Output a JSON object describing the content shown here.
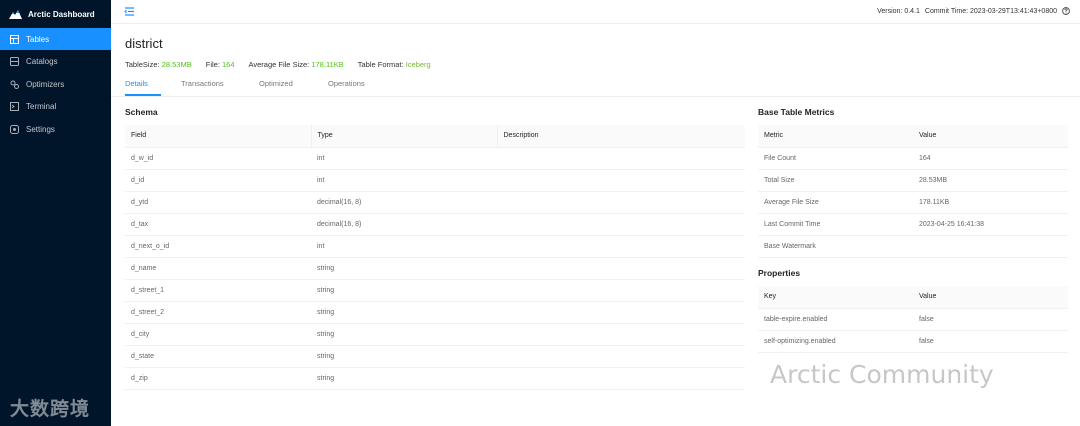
{
  "app": {
    "title": "Arctic Dashboard"
  },
  "nav": [
    {
      "label": "Tables",
      "icon": "table-icon",
      "active": true
    },
    {
      "label": "Catalogs",
      "icon": "database-icon",
      "active": false
    },
    {
      "label": "Optimizers",
      "icon": "gear-cluster-icon",
      "active": false
    },
    {
      "label": "Terminal",
      "icon": "terminal-icon",
      "active": false
    },
    {
      "label": "Settings",
      "icon": "settings-icon",
      "active": false
    }
  ],
  "topbar": {
    "version": "Version: 0.4.1",
    "commit": "Commit Time: 2023-03-29T13:41:43+0800"
  },
  "page": {
    "title": "district",
    "stats": [
      {
        "label": "TableSize:",
        "value": "28.53MB"
      },
      {
        "label": "File:",
        "value": "164"
      },
      {
        "label": "Average File Size:",
        "value": "178.11KB"
      },
      {
        "label": "Table Format:",
        "value": "Iceberg"
      }
    ]
  },
  "tabs": [
    "Details",
    "Transactions",
    "Optimized",
    "Operations"
  ],
  "schema": {
    "title": "Schema",
    "headers": [
      "Field",
      "Type",
      "Description"
    ],
    "rows": [
      [
        "d_w_id",
        "int",
        ""
      ],
      [
        "d_id",
        "int",
        ""
      ],
      [
        "d_ytd",
        "decimal(16, 8)",
        ""
      ],
      [
        "d_tax",
        "decimal(16, 8)",
        ""
      ],
      [
        "d_next_o_id",
        "int",
        ""
      ],
      [
        "d_name",
        "string",
        ""
      ],
      [
        "d_street_1",
        "string",
        ""
      ],
      [
        "d_street_2",
        "string",
        ""
      ],
      [
        "d_city",
        "string",
        ""
      ],
      [
        "d_state",
        "string",
        ""
      ],
      [
        "d_zip",
        "string",
        ""
      ]
    ]
  },
  "metrics": {
    "title": "Base Table Metrics",
    "headers": [
      "Metric",
      "Value"
    ],
    "rows": [
      [
        "File Count",
        "164"
      ],
      [
        "Total Size",
        "28.53MB"
      ],
      [
        "Average File Size",
        "178.11KB"
      ],
      [
        "Last Commit Time",
        "2023-04-25 16:41:38"
      ],
      [
        "Base Watermark",
        ""
      ]
    ]
  },
  "properties": {
    "title": "Properties",
    "headers": [
      "Key",
      "Value"
    ],
    "rows": [
      [
        "table-expire.enabled",
        "false"
      ],
      [
        "self-optimizing.enabled",
        "false"
      ]
    ]
  },
  "watermarks": {
    "left": "大数跨境",
    "right": "Arctic Community"
  },
  "colors": {
    "sidebar": "#001529",
    "accent": "#1890ff",
    "value_green": "#52c41a"
  }
}
